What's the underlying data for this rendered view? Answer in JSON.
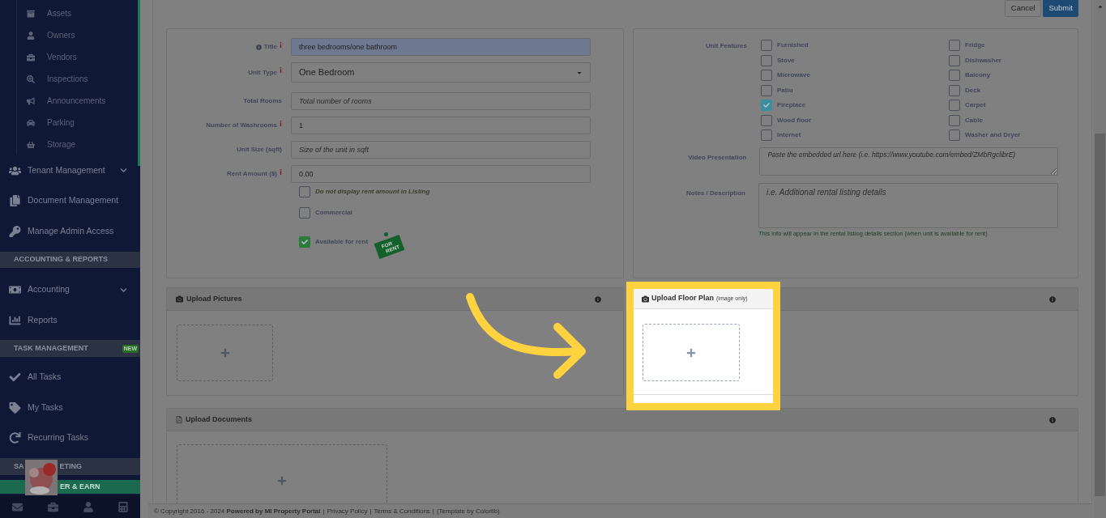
{
  "sidebar": {
    "sub_items": [
      {
        "label": "Assets"
      },
      {
        "label": "Owners"
      },
      {
        "label": "Vendors"
      },
      {
        "label": "Inspections"
      },
      {
        "label": "Announcements"
      },
      {
        "label": "Parking"
      },
      {
        "label": "Storage"
      }
    ],
    "entries": [
      {
        "kind": "item",
        "label": "Tenant Management",
        "expandable": true
      },
      {
        "kind": "item",
        "label": "Document Management",
        "expandable": false
      },
      {
        "kind": "item",
        "label": "Manage Admin Access",
        "expandable": false
      },
      {
        "kind": "section",
        "label": "ACCOUNTING & REPORTS"
      },
      {
        "kind": "item",
        "label": "Accounting",
        "expandable": true
      },
      {
        "kind": "item",
        "label": "Reports",
        "expandable": false
      },
      {
        "kind": "section",
        "label": "TASK MANAGEMENT",
        "badge": "NEW"
      },
      {
        "kind": "item",
        "label": "All Tasks",
        "expandable": false
      },
      {
        "kind": "item",
        "label": "My Tasks",
        "expandable": false
      },
      {
        "kind": "item",
        "label": "Recurring Tasks",
        "expandable": false
      },
      {
        "kind": "section",
        "label": "SA",
        "label_end": "ETING"
      },
      {
        "kind": "promo",
        "label": "ER & EARN"
      }
    ]
  },
  "actions": [
    {
      "label": "Cancel",
      "primary": false
    },
    {
      "label": "Submit",
      "primary": true
    }
  ],
  "unit_form": {
    "fields": [
      {
        "kind": "input",
        "label": "Title",
        "info": true,
        "required": true,
        "value": "three bedrooms/one bathroom",
        "highlighted": true
      },
      {
        "kind": "select",
        "label": "Unit Type",
        "info": false,
        "required": true,
        "value": "One Bedroom",
        "highlighted": false
      },
      {
        "kind": "input",
        "label": "Total Rooms",
        "info": false,
        "required": false,
        "placeholder": "Total number of rooms",
        "highlighted": false
      },
      {
        "kind": "input",
        "label": "Number of Washrooms",
        "info": false,
        "required": true,
        "value": "1",
        "highlighted": false
      },
      {
        "kind": "input",
        "label": "Unit Size (sqft)",
        "info": false,
        "required": false,
        "placeholder": "Size of the unit in sqft",
        "highlighted": false
      },
      {
        "kind": "input",
        "label": "Rent Amount ($)",
        "info": false,
        "required": true,
        "value": "0.00",
        "highlighted": false
      }
    ],
    "options": [
      {
        "label": "Do not display rent amount in Listing",
        "checked": false,
        "italic": true
      },
      {
        "label": "Commercial",
        "checked": false,
        "italic": false
      },
      {
        "label": "Available for rent",
        "checked": true,
        "italic": false,
        "sign": [
          "FOR",
          "RENT"
        ]
      }
    ]
  },
  "features": {
    "label": "Unit Features",
    "columns": [
      [
        {
          "label": "Furnished",
          "checked": false
        },
        {
          "label": "Stove",
          "checked": false
        },
        {
          "label": "Microwave",
          "checked": false
        },
        {
          "label": "Patio",
          "checked": false
        },
        {
          "label": "Fireplace",
          "checked": true
        },
        {
          "label": "Wood floor",
          "checked": false
        },
        {
          "label": "Internet",
          "checked": false
        }
      ],
      [
        {
          "label": "Fridge",
          "checked": false
        },
        {
          "label": "Dishwasher",
          "checked": false
        },
        {
          "label": "Balcony",
          "checked": false
        },
        {
          "label": "Deck",
          "checked": false
        },
        {
          "label": "Carpet",
          "checked": false
        },
        {
          "label": "Cable",
          "checked": false
        },
        {
          "label": "Washer and Dryer",
          "checked": false
        }
      ]
    ],
    "video": {
      "label": "Video Presentation",
      "placeholder": "Paste the embedded url here (i.e. https://www.youtube.com/embed/ZMbRgclibrE)"
    },
    "notes": {
      "label": "Notes / Description",
      "placeholder": "i.e. Additional rental listing details",
      "help": "This info will appear in the rental listing details section (when unit is available for rent)"
    }
  },
  "upload_pictures": {
    "title": "Upload Pictures"
  },
  "upload_floor_plan": {
    "title": "Upload Floor Plan",
    "note": "(image only)",
    "highlighted": true
  },
  "upload_documents": {
    "title": "Upload Documents"
  },
  "footer": {
    "copyright": "© Copyright 2016 - 2024 **Powered by MI Property Portal**",
    "separator": "|",
    "links": [
      "Privacy Policy",
      "Terms & Conditions"
    ],
    "credit": "(Template by Colorlib)"
  }
}
